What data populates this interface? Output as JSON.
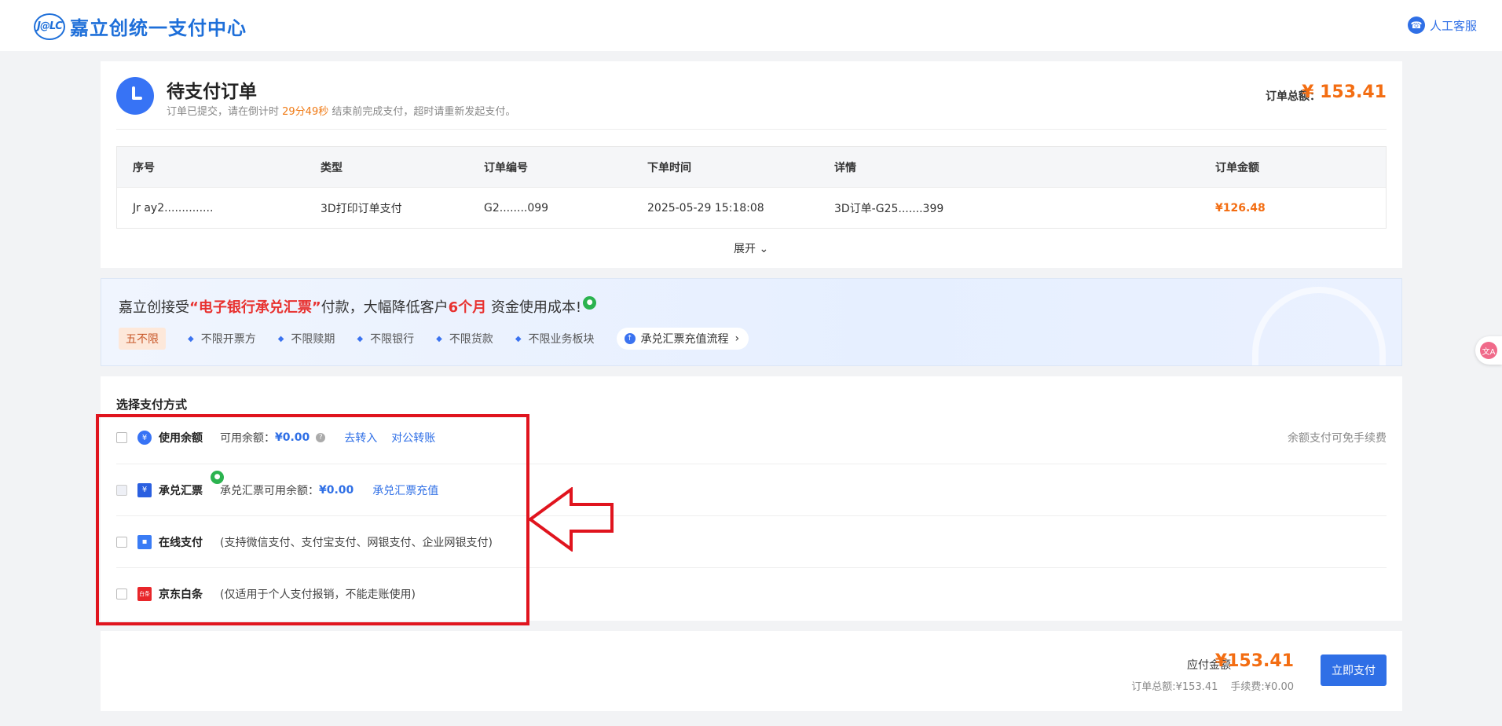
{
  "header": {
    "logo_mark": "J@LC",
    "brand": "嘉立创统一支付中心",
    "service_label": "人工客服"
  },
  "order": {
    "title": "待支付订单",
    "sub_prefix": "订单已提交，请在倒计时 ",
    "countdown": "29分49秒",
    "sub_suffix": " 结束前完成支付，超时请重新发起支付。",
    "total_label": "订单总额：",
    "total_value": "¥ 153.41",
    "table": {
      "headers": [
        "序号",
        "类型",
        "订单编号",
        "下单时间",
        "详情",
        "订单金额"
      ],
      "rows": [
        [
          "Jr ay2..............",
          "3D打印订单支付",
          "G2........099",
          "2025-05-29 15:18:08",
          "3D订单-G25.......399",
          "¥126.48"
        ]
      ]
    },
    "expand_label": "展开 ⌄"
  },
  "banner": {
    "title_prefix": "嘉立创接受",
    "title_highlight": "“电子银行承兑汇票”",
    "title_mid": "付款，大幅降低客户",
    "title_months": "6个月",
    "title_suffix": "资金使用成本!",
    "chip_main": "五不限",
    "chips": [
      "不限开票方",
      "不限赎期",
      "不限银行",
      "不限货款",
      "不限业务板块"
    ],
    "flow_button": "承兑汇票充值流程"
  },
  "payment": {
    "heading": "选择支付方式",
    "balance": {
      "name": "使用余额",
      "available_label": "可用余额：",
      "available_value": "¥0.00",
      "transfer_in": "去转入",
      "corporate_transfer": "对公转账",
      "fee_note": "余额支付可免手续费"
    },
    "bill": {
      "name": "承兑汇票",
      "available_label": "承兑汇票可用余额：",
      "available_value": "¥0.00",
      "recharge": "承兑汇票充值"
    },
    "online": {
      "name": "在线支付",
      "desc": "(支持微信支付、支付宝支付、网银支付、企业网银支付)"
    },
    "jd": {
      "name": "京东白条",
      "desc": "(仅适用于个人支付报销，不能走账使用)"
    }
  },
  "footer": {
    "due_label": "应付金额",
    "due_value": "¥153.41",
    "order_total": "订单总额:¥153.41",
    "fee": "手续费:¥0.00",
    "pay_button": "立即支付"
  },
  "colors": {
    "accent": "#2f6fe6",
    "price": "#f36d12",
    "highlight_red": "#e8312f",
    "annotation_red": "#e0141e"
  }
}
